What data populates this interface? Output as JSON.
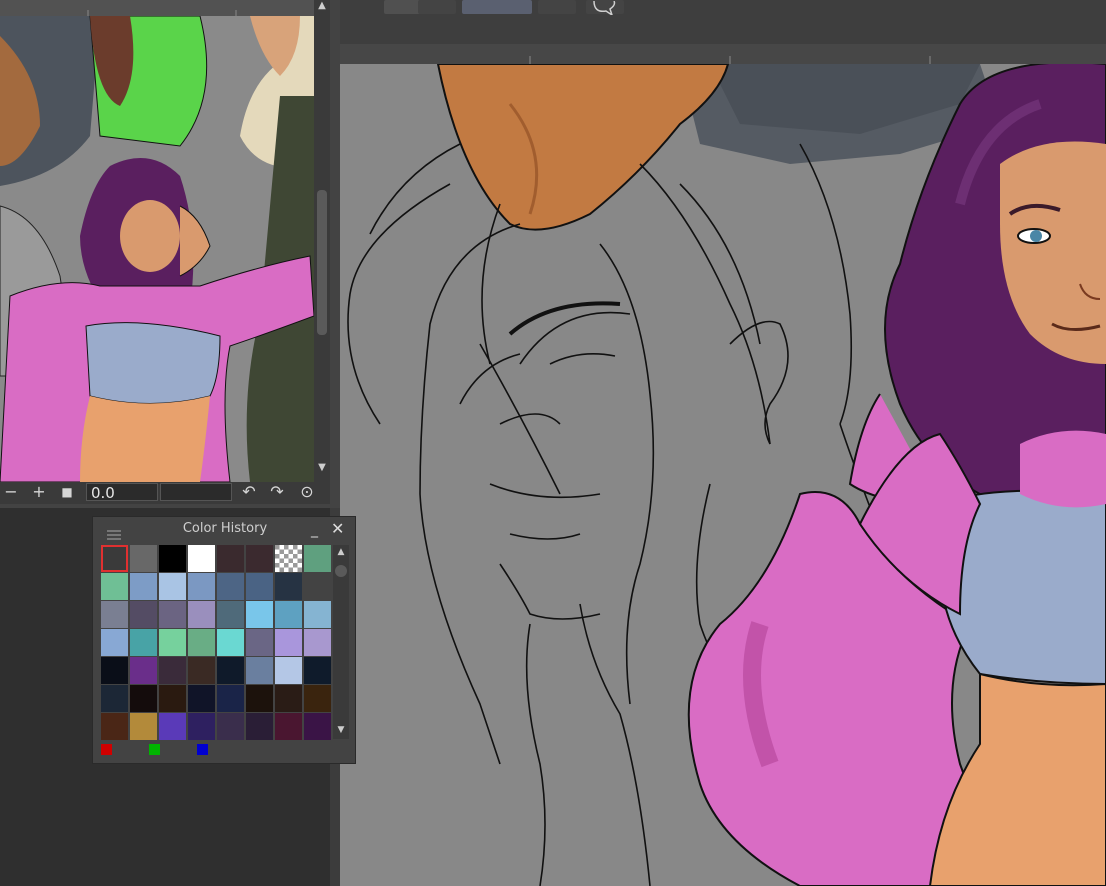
{
  "navigator": {
    "rotation_value": "0.0"
  },
  "color_history": {
    "title": "Color History",
    "swatches": [
      [
        "#3a3a3a",
        "#686868",
        "#000000",
        "#ffffff",
        "#3a2a2e",
        "#3b2a2f",
        "checker",
        "#5fa07f"
      ],
      [
        "#6fbf95",
        "#7d9cc6",
        "#a9c4e4",
        "#7b98c2",
        "#4d6585",
        "#4a6384",
        "#263343",
        ""
      ],
      [
        "#7a7f92",
        "#544c64",
        "#6b6482",
        "#9a8fbd",
        "#4f6a7a",
        "#79c6ea",
        "#5ea1c1",
        "#85b4d2"
      ],
      [
        "#88a8d4",
        "#48a3a6",
        "#76d19d",
        "#69ad85",
        "#6ad8d2",
        "#6a6685",
        "#a996dc",
        "#a898cf"
      ],
      [
        "#0a0e18",
        "#6a2e8a",
        "#3a2b3a",
        "#3a2a24",
        "#0f1a2a",
        "#6a7f9f",
        "#b4c7e6",
        "#0f1b2b"
      ],
      [
        "#1c2736",
        "#140c0c",
        "#2a1a10",
        "#101428",
        "#1a2448",
        "#1c120c",
        "#2a1c16",
        "#3a240e"
      ],
      [
        "#4a2616",
        "#b38a3a",
        "#5a3ab8",
        "#2e2060",
        "#3a2e4c",
        "#2a1e36",
        "#4a1630",
        "#3a1446"
      ]
    ],
    "rgb": {
      "red": "#d10000",
      "green": "#00b400",
      "blue": "#0000d0"
    }
  }
}
